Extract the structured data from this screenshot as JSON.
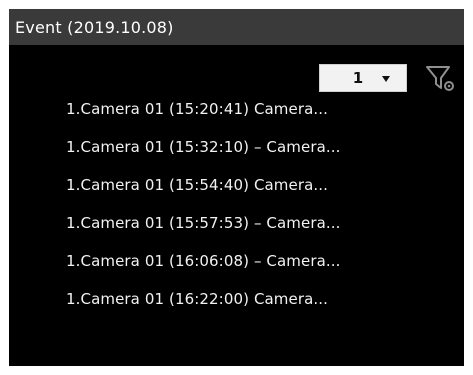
{
  "header": {
    "title": "Event (2019.10.08)"
  },
  "toolbar": {
    "dropdown_value": "1",
    "dropdown_icon": "chevron-down-icon",
    "filter_icon": "filter-settings-icon"
  },
  "events": [
    {
      "label": "1.Camera 01 (15:20:41)   Camera..."
    },
    {
      "label": "1.Camera 01 (15:32:10) – Camera..."
    },
    {
      "label": "1.Camera 01 (15:54:40)   Camera..."
    },
    {
      "label": "1.Camera 01 (15:57:53) – Camera..."
    },
    {
      "label": "1.Camera 01 (16:06:08) – Camera..."
    },
    {
      "label": "1.Camera 01 (16:22:00)   Camera..."
    }
  ],
  "colors": {
    "background": "#000000",
    "header_background": "#3a3a3a",
    "text": "#f2f2f2",
    "dropdown_background": "#f2f2f2"
  }
}
